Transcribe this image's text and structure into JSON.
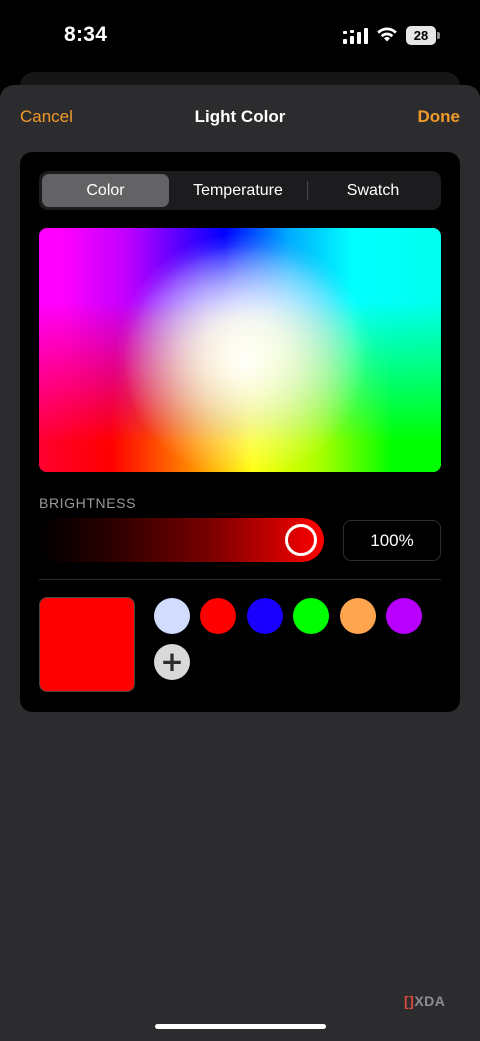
{
  "status_bar": {
    "time": "8:34",
    "battery_level": "28",
    "icons": [
      "signal-icon",
      "wifi-icon",
      "battery-icon"
    ]
  },
  "nav": {
    "cancel_label": "Cancel",
    "title": "Light Color",
    "done_label": "Done",
    "accent_color": "#f09a2a"
  },
  "segmented_control": {
    "tabs": [
      {
        "label": "Color",
        "selected": true
      },
      {
        "label": "Temperature",
        "selected": false
      },
      {
        "label": "Swatch",
        "selected": false
      }
    ]
  },
  "color_picker": {
    "type": "hue-saturation-field"
  },
  "brightness": {
    "label": "BRIGHTNESS",
    "value_text": "100%",
    "level": 1.0,
    "track_color": "#ff0000"
  },
  "current_color": "#ff0000",
  "favorites": [
    {
      "color": "#d2dcff"
    },
    {
      "color": "#ff0000"
    },
    {
      "color": "#1a00ff"
    },
    {
      "color": "#00ff00"
    },
    {
      "color": "#ffa550"
    },
    {
      "color": "#b700ff"
    }
  ],
  "add_favorite_icon": "plus-icon",
  "watermark": {
    "mark": "[]",
    "text": "XDA"
  }
}
